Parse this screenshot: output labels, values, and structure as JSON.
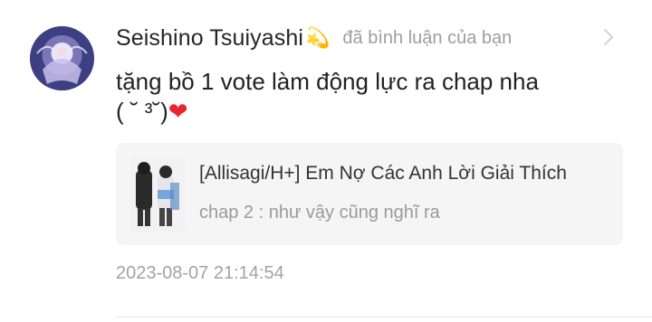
{
  "notification": {
    "username": "Seishino Tsuiyashi",
    "username_emoji": "💫",
    "action_text": "đã bình luận của bạn",
    "comment_line1": "tặng bồ 1 vote làm động lực ra chap nha",
    "comment_line2_text": "( ˘ ³˘)",
    "comment_line2_heart": "❤",
    "reference": {
      "title": "[Allisagi/H+] Em Nợ Các Anh Lời Giải Thích",
      "subtitle": "chap 2 : như vậy cũng nghĩ ra"
    },
    "timestamp": "2023-08-07 21:14:54"
  },
  "icons": {
    "avatar": "user-avatar",
    "chevron": "chevron-right-icon",
    "thumbnail": "story-cover-thumbnail"
  }
}
